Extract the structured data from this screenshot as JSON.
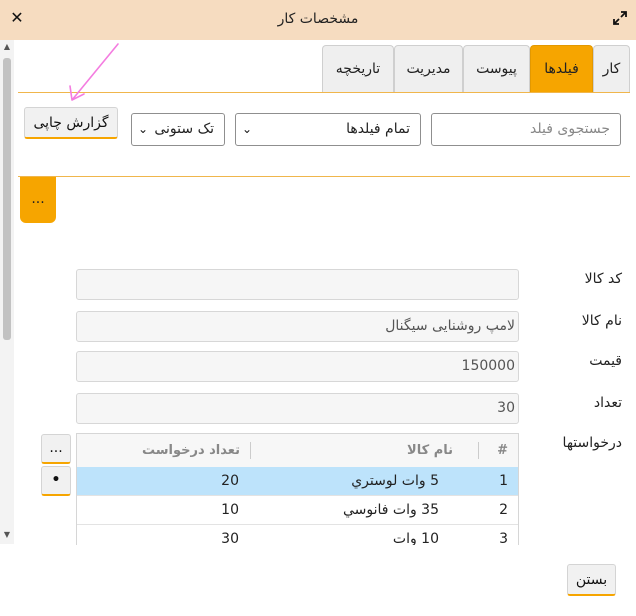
{
  "window": {
    "title": "مشخصات کار",
    "close_glyph": "✕",
    "icons": {
      "close": "close-icon",
      "expand": "expand-icon"
    }
  },
  "scrollbar": {
    "up_glyph": "▲",
    "down_glyph": "▼"
  },
  "tabs": [
    {
      "label": "کار",
      "active": false
    },
    {
      "label": "فیلدها",
      "active": true
    },
    {
      "label": "پیوست",
      "active": false
    },
    {
      "label": "مدیریت",
      "active": false
    },
    {
      "label": "تاریخچه",
      "active": false
    }
  ],
  "toolbar": {
    "search_placeholder": "جستجوی فیلد",
    "fields_select": "تمام فیلدها",
    "columns_select": "تک ستونی",
    "print_button": "گزارش چاپی",
    "chevron_glyph": "⌄"
  },
  "more_button": "...",
  "form": {
    "code_label": "کد کالا",
    "code_value": "",
    "name_label": "نام کالا",
    "name_value": "لامپ روشنایی سیگنال",
    "price_label": "قیمت",
    "price_value": "150000",
    "qty_label": "تعداد",
    "qty_value": "30",
    "requests_label": "درخواستها"
  },
  "requests_table": {
    "headers": {
      "index": "#",
      "name": "نام کالا",
      "count": "تعداد درخواست"
    },
    "rows": [
      {
        "index": "1",
        "name": "5 وات لوستري",
        "count": "20",
        "selected": true
      },
      {
        "index": "2",
        "name": "35 وات فانوسي",
        "count": "10",
        "selected": false
      },
      {
        "index": "3",
        "name": "10 وات",
        "count": "30",
        "selected": false
      }
    ]
  },
  "side_buttons": {
    "more": "...",
    "bullet": "•"
  },
  "footer": {
    "close_button": "بستن"
  },
  "colors": {
    "accent": "#f6a500",
    "titlebar": "#f6dcc0",
    "selected_row": "#bde3fb"
  }
}
